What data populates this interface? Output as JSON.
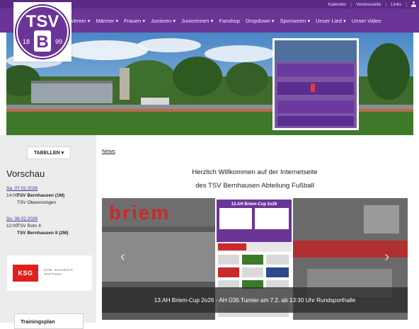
{
  "utility_links": [
    "Kalender",
    "Vereinsseite",
    "Links"
  ],
  "nav": {
    "items": [
      "Verein",
      "Männer",
      "Frauen",
      "Junioren",
      "Juniorinnen",
      "Fanshop",
      "Dropdown",
      "Sponsoren",
      "Unser Lied",
      "Unser Video"
    ]
  },
  "logo": {
    "text_top": "TSV",
    "letter": "B",
    "year_left": "18",
    "year_right": "99"
  },
  "sidebar": {
    "tabellen_label": "TABELLEN",
    "section_title": "Vorschau",
    "matches": [
      {
        "date": "Sa. 07.02.2026",
        "time": "14:00",
        "home": "TSV Bernhausen (1M)",
        "away": "TSV Oberensingen",
        "away_bold": false
      },
      {
        "date": "So. 08.02.2026",
        "time": "12:00",
        "home": "TSV Rohr II",
        "away": "TSV Bernhausen II (2M)",
        "away_bold": true
      }
    ],
    "sponsor": {
      "mark": "KSG",
      "line1": "KARL SCHLECHT",
      "line2": "STIFTUNG"
    },
    "training_label": "Trainingsplan"
  },
  "content": {
    "news_label": "News",
    "welcome_line1": "Herzlich Willkommen auf der Internetseite",
    "welcome_line2": "des TSV Bernhausen Abteilung Fußball",
    "slider": {
      "caption": "13.AH Briem-Cup 2o26 - AH Ü35 Turnier am 7.2. ab 13:30 Uhr Rundsporthalle",
      "poster_title": "13.AH Briem-Cup 2o26",
      "banner_text": "briem",
      "prev_label": "‹",
      "next_label": "›"
    }
  },
  "colors": {
    "brand_purple": "#6b3598",
    "topbar_purple": "#5c2a86",
    "sponsor_red": "#e0201c"
  }
}
